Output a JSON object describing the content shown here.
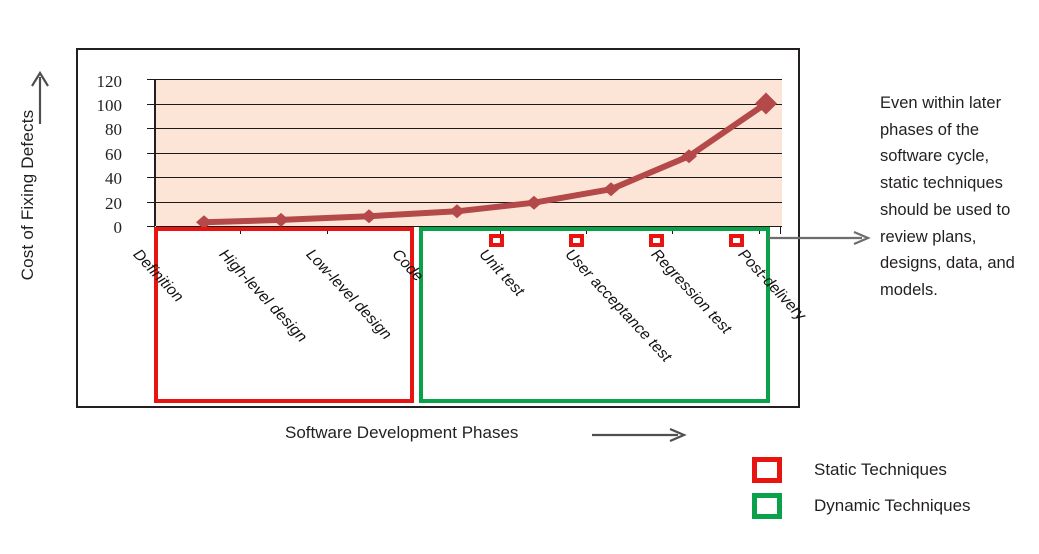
{
  "axes": {
    "y_title": "Cost of Fixing Defects",
    "x_caption": "Software Development Phases"
  },
  "callout": {
    "text": "Even within later phases of the software cycle, static techniques should be used to review plans, designs, data, and models."
  },
  "legend": {
    "items": [
      {
        "label": "Static Techniques",
        "color": "#e8140f"
      },
      {
        "label": "Dynamic Techniques",
        "color": "#0aa14b"
      }
    ]
  },
  "boxes": {
    "static_label": "Static Techniques region",
    "dynamic_label": "Dynamic Techniques region"
  },
  "chart_data": {
    "type": "line",
    "title": "",
    "xlabel": "Software Development Phases",
    "ylabel": "Cost of Fixing Defects",
    "categories": [
      "Definition",
      "High-level design",
      "Low-level design",
      "Code",
      "Unit test",
      "User acceptance test",
      "Regression test",
      "Post-delivery"
    ],
    "values": [
      3,
      5,
      8,
      12,
      19,
      30,
      57,
      100
    ],
    "yticks": [
      0,
      20,
      40,
      60,
      80,
      100,
      120
    ],
    "ylim": [
      0,
      120
    ],
    "grid": true,
    "legend_position": "bottom-right",
    "series_color": "#b4494a",
    "plot_background": "#fce5d6",
    "marker": "diamond"
  }
}
